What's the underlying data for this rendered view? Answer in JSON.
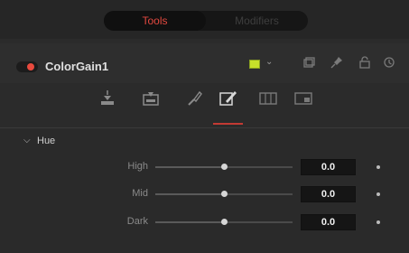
{
  "tabs": [
    {
      "label": "Tools",
      "active": true
    },
    {
      "label": "Modifiers",
      "active": false
    }
  ],
  "node": {
    "title": "ColorGain1",
    "color": "#c6e02a",
    "toggle_color": "#e84a3e",
    "header_icons": [
      "version-icon",
      "pin-icon",
      "lock-icon",
      "reset-icon"
    ]
  },
  "subtabs": [
    {
      "name": "gain-tab-icon"
    },
    {
      "name": "balance-tab-icon"
    },
    {
      "name": "hue-tab-icon"
    },
    {
      "name": "ranges-tab-icon",
      "active": true
    },
    {
      "name": "options-tab-icon"
    },
    {
      "name": "settings-tab-icon"
    }
  ],
  "section": {
    "title": "Hue",
    "expanded": true,
    "rows": [
      {
        "label": "High",
        "value": "0.0",
        "level": 0.5
      },
      {
        "label": "Mid",
        "value": "0.0",
        "level": 0.5
      },
      {
        "label": "Dark",
        "value": "0.0",
        "level": 0.5
      }
    ]
  },
  "colors": {
    "accent": "#e2483f",
    "background": "#2b2b2b"
  }
}
